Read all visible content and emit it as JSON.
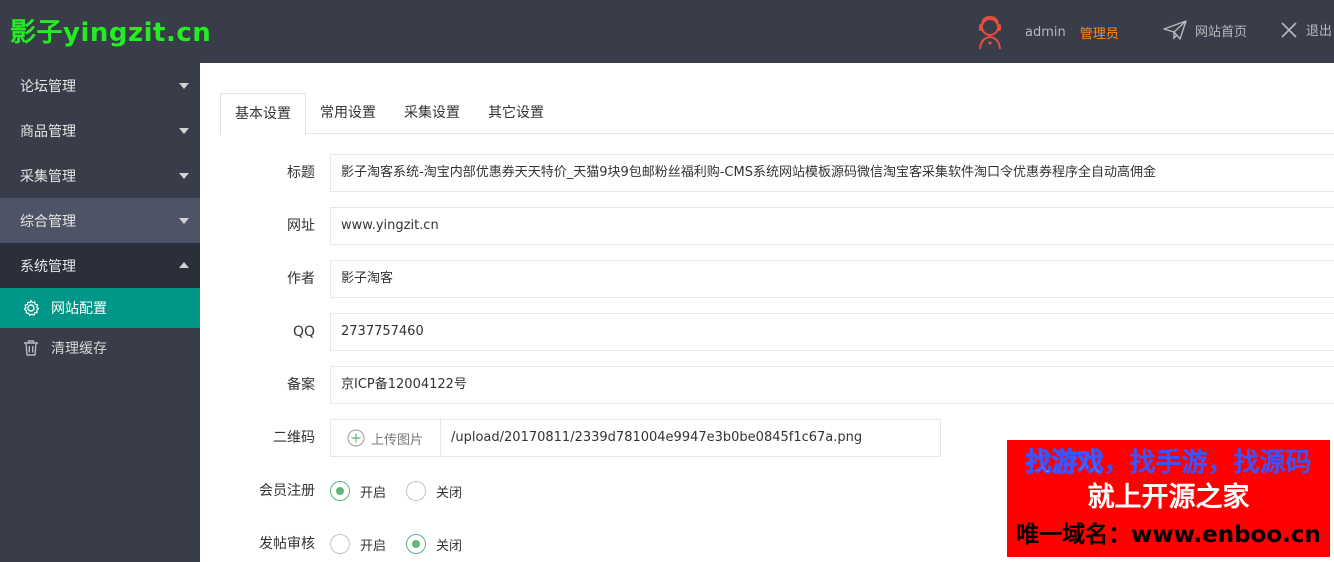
{
  "header": {
    "logo": "影子yingzit.cn",
    "username": "admin",
    "role": "管理员",
    "home_link": "网站首页",
    "logout_link": "退出",
    "colors": {
      "bg": "#393d49",
      "logo": "#22ee22",
      "role": "#ff8a1a"
    }
  },
  "sidebar": {
    "items": [
      {
        "label": "论坛管理"
      },
      {
        "label": "商品管理"
      },
      {
        "label": "采集管理"
      },
      {
        "label": "综合管理"
      },
      {
        "label": "系统管理"
      }
    ],
    "sub_items": [
      {
        "label": "网站配置",
        "icon": "gear-icon"
      },
      {
        "label": "清理缓存",
        "icon": "trash-icon"
      }
    ],
    "colors": {
      "active": "#009688"
    }
  },
  "tabs": [
    "基本设置",
    "常用设置",
    "采集设置",
    "其它设置"
  ],
  "form": {
    "title_label": "标题",
    "title_value": "影子淘客系统-淘宝内部优惠券天天特价_天猫9块9包邮粉丝福利购-CMS系统网站模板源码微信淘宝客采集软件淘口令优惠券程序全自动高佣金",
    "url_label": "网址",
    "url_value": "www.yingzit.cn",
    "author_label": "作者",
    "author_value": "影子淘客",
    "qq_label": "QQ",
    "qq_value": "2737757460",
    "icp_label": "备案",
    "icp_value": "京ICP备12004122号",
    "qrcode_label": "二维码",
    "upload_label": "上传图片",
    "qrcode_path": "/upload/20170811/2339d781004e9947e3b0be0845f1c67a.png",
    "register_label": "会员注册",
    "register_on": "开启",
    "register_off": "关闭",
    "post_review_label": "发帖审核",
    "post_review_on": "开启",
    "post_review_off": "关闭"
  },
  "ad": {
    "line1_a": "找游戏",
    "line1_b": "，找手游，找源码",
    "line2": "就上开源之家",
    "line3": "唯一域名：www.enboo.cn"
  }
}
